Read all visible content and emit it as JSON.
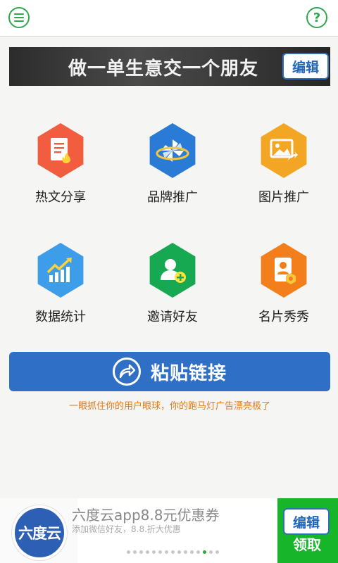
{
  "header": {
    "menu_icon": "menu-icon",
    "help_icon": "help-icon",
    "help_glyph": "?",
    "accent": "#2fa84f"
  },
  "banner": {
    "text": "做一单生意交一个朋友",
    "edit_label": "编辑"
  },
  "grid": [
    {
      "label": "热文分享",
      "icon": "hot-article-icon",
      "color": "#f25c3f"
    },
    {
      "label": "品牌推广",
      "icon": "brand-promotion-icon",
      "color": "#2a7bd6"
    },
    {
      "label": "图片推广",
      "icon": "image-promotion-icon",
      "color": "#f2a623"
    },
    {
      "label": "数据统计",
      "icon": "statistics-icon",
      "color": "#3d9de8"
    },
    {
      "label": "邀请好友",
      "icon": "invite-friend-icon",
      "color": "#16a952"
    },
    {
      "label": "名片秀秀",
      "icon": "business-card-icon",
      "color": "#f27f1c"
    }
  ],
  "paste": {
    "label": "粘贴链接",
    "icon": "share-arrow-icon",
    "color": "#2f6fc6"
  },
  "tip": "一眼抓住你的用户眼球，你的跑马灯广告漂亮极了",
  "ad": {
    "logo_text": "六度云",
    "title": "六度云app8.8元优惠券",
    "subtitle": "添加微信好友，8.8.折大优惠",
    "edit_label": "编辑",
    "claim_label": "领取",
    "dots_total": 15,
    "dots_active_index": 12
  }
}
